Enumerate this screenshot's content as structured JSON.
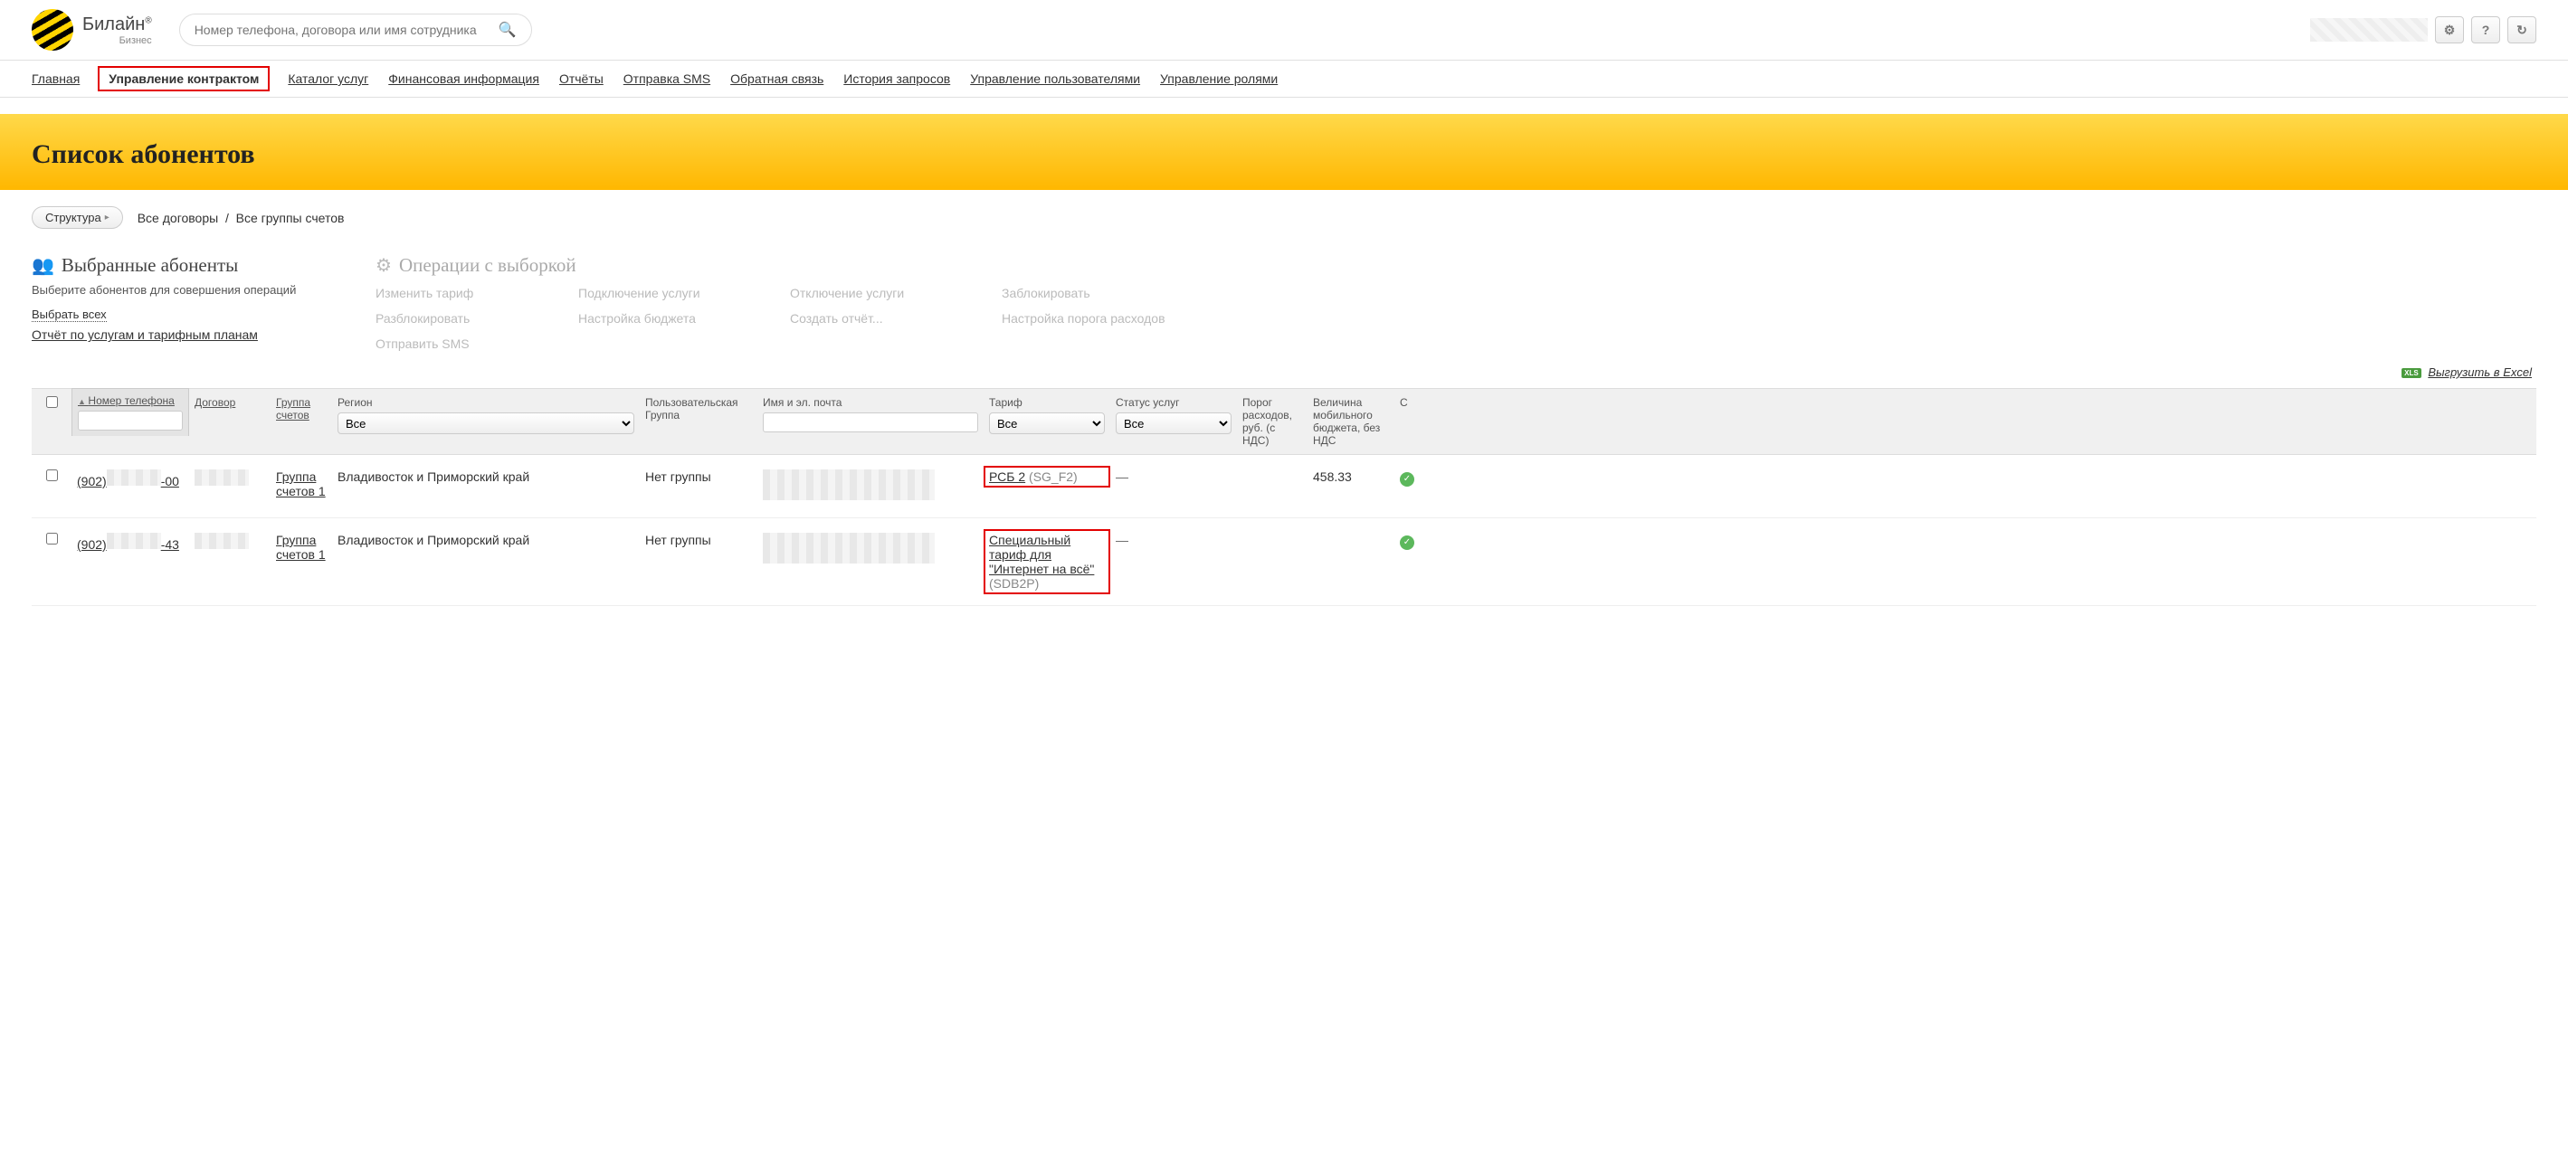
{
  "header": {
    "logo_name": "Билайн",
    "logo_reg": "®",
    "logo_sub": "Бизнес",
    "search_placeholder": "Номер телефона, договора или имя сотрудника"
  },
  "nav": {
    "items": [
      "Главная",
      "Управление контрактом",
      "Каталог услуг",
      "Финансовая информация",
      "Отчёты",
      "Отправка SMS",
      "Обратная связь",
      "История запросов",
      "Управление пользователями",
      "Управление ролями"
    ],
    "active_index": 1
  },
  "banner": {
    "title": "Список абонентов"
  },
  "breadcrumb": {
    "structure_btn": "Структура",
    "path1": "Все договоры",
    "path2": "Все группы счетов"
  },
  "selected": {
    "title": "Выбранные абоненты",
    "sub": "Выберите абонентов для совершения операций",
    "select_all": "Выбрать всех",
    "report": "Отчёт по услугам и тарифным планам"
  },
  "ops": {
    "title": "Операции с выборкой",
    "items": [
      "Изменить тариф",
      "Подключение услуги",
      "Отключение услуги",
      "Заблокировать",
      "Разблокировать",
      "Настройка бюджета",
      "Создать отчёт...",
      "Настройка порога расходов",
      "Отправить SMS"
    ]
  },
  "export": {
    "label": "Выгрузить в Excel",
    "badge": "XLS"
  },
  "table": {
    "headers": {
      "phone": "Номер телефона",
      "contract": "Договор",
      "group": "Группа счетов",
      "region": "Регион",
      "usergroup": "Пользовательская Группа",
      "name": "Имя и эл. почта",
      "tariff": "Тариф",
      "status": "Статус услуг",
      "limit": "Порог расходов, руб. (с НДС)",
      "budget": "Величина мобильного бюджета, без НДС",
      "last": "С"
    },
    "region_all": "Все",
    "tariff_all": "Все",
    "status_all": "Все",
    "rows": [
      {
        "phone_prefix": "(902)",
        "phone_suffix": "-00",
        "group": "Группа счетов 1",
        "region": "Владивосток и Приморский край",
        "usergroup": "Нет группы",
        "tariff_name": "РСБ 2",
        "tariff_code": "(SG_F2)",
        "status": "—",
        "limit": "",
        "budget": "458.33"
      },
      {
        "phone_prefix": "(902)",
        "phone_suffix": "-43",
        "group": "Группа счетов 1",
        "region": "Владивосток и Приморский край",
        "usergroup": "Нет группы",
        "tariff_name": "Специальный тариф для \"Интернет на всё\"",
        "tariff_code": "(SDB2P)",
        "status": "—",
        "limit": "",
        "budget": ""
      }
    ]
  }
}
